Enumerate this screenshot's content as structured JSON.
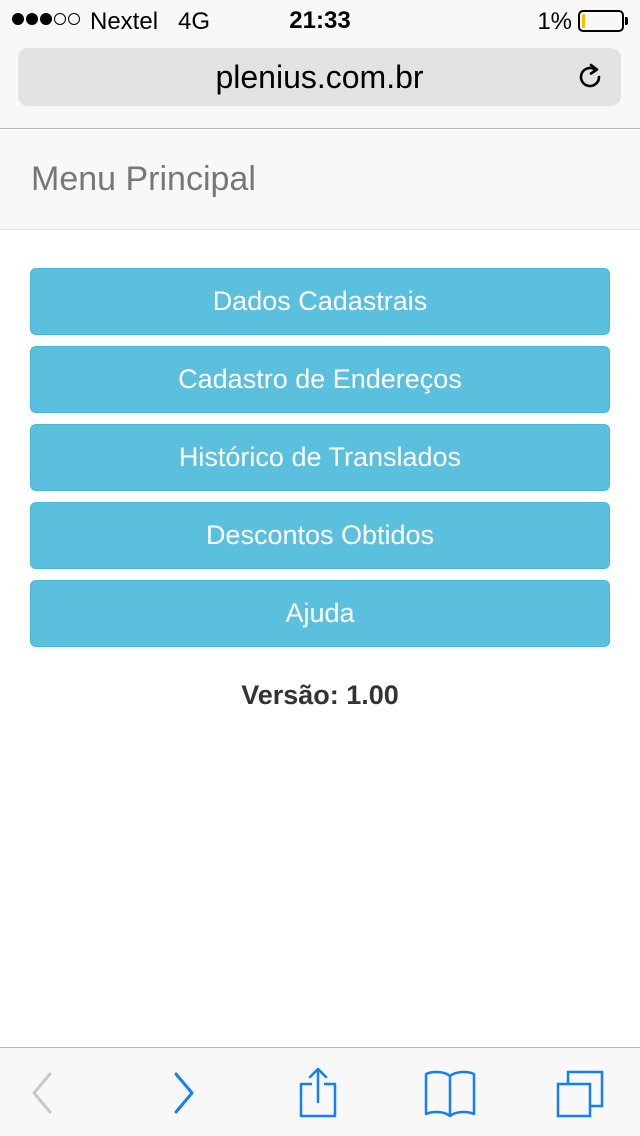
{
  "status_bar": {
    "carrier": "Nextel",
    "network": "4G",
    "time": "21:33",
    "battery_percent": "1%"
  },
  "browser": {
    "url": "plenius.com.br",
    "reload_icon": "reload-icon"
  },
  "page": {
    "title": "Menu Principal",
    "menu_items": [
      {
        "label": "Dados Cadastrais"
      },
      {
        "label": "Cadastro de Endereços"
      },
      {
        "label": "Histórico de Translados"
      },
      {
        "label": "Descontos Obtidos"
      },
      {
        "label": "Ajuda"
      }
    ],
    "version": "Versão: 1.00"
  },
  "toolbar": {
    "icons": [
      "back-icon",
      "forward-icon",
      "share-icon",
      "bookmarks-icon",
      "tabs-icon"
    ]
  },
  "colors": {
    "button_bg": "#5bc0de",
    "button_border": "#46b8da",
    "accent_blue": "#157efb",
    "disabled_gray": "#c7c7cc",
    "battery_low": "#f2c200"
  }
}
